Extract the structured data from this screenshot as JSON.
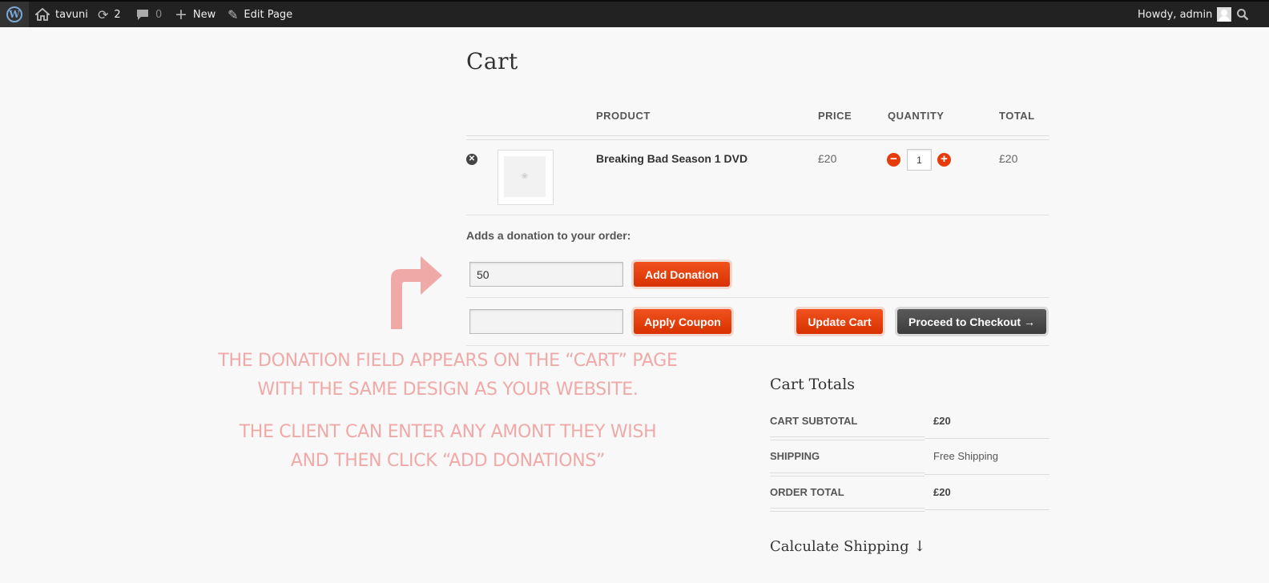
{
  "adminbar": {
    "site_name": "tavuni",
    "updates_count": "2",
    "comments_count": "0",
    "new_label": "New",
    "edit_label": "Edit Page",
    "howdy": "Howdy, admin"
  },
  "page": {
    "title": "Cart"
  },
  "cart": {
    "headers": {
      "product": "PRODUCT",
      "price": "PRICE",
      "quantity": "QUANTITY",
      "total": "TOTAL"
    },
    "item": {
      "name": "Breaking Bad Season 1 DVD",
      "price": "£20",
      "quantity": "1",
      "total": "£20"
    }
  },
  "donation": {
    "label": "Adds a donation to your order:",
    "value": "50",
    "button": "Add Donation"
  },
  "actions": {
    "coupon_value": "",
    "apply_coupon": "Apply Coupon",
    "update_cart": "Update Cart",
    "checkout": "Proceed to Checkout →"
  },
  "annotation": {
    "line1": "THE DONATION FIELD APPEARS ON THE “CART” PAGE",
    "line2": "WITH THE SAME DESIGN AS YOUR WEBSITE.",
    "line3": "THE CLIENT CAN ENTER ANY AMONT THEY WISH",
    "line4": "AND THEN CLICK “ADD DONATIONS”",
    "color": "#efaaa8"
  },
  "totals": {
    "title": "Cart Totals",
    "rows": [
      {
        "label": "CART SUBTOTAL",
        "value": "£20"
      },
      {
        "label": "SHIPPING",
        "value": "Free Shipping"
      },
      {
        "label": "ORDER TOTAL",
        "value": "£20"
      }
    ],
    "calc_shipping": "Calculate Shipping ↓"
  },
  "colors": {
    "accent": "#e63c0c",
    "adminbar": "#222222",
    "dark_button": "#444444"
  }
}
